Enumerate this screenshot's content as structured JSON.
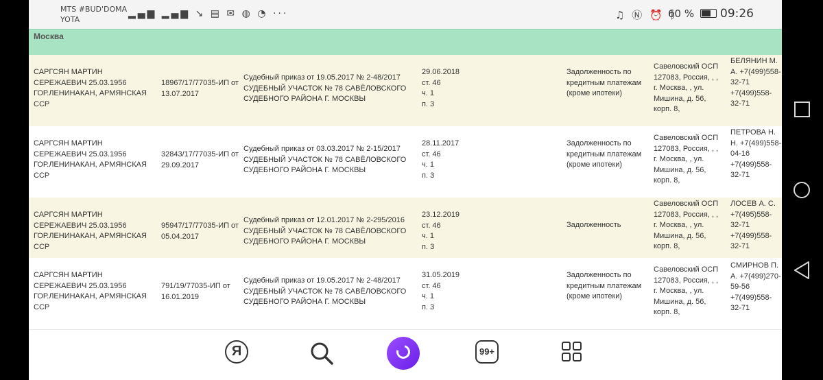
{
  "status_bar": {
    "carrier_line1": "MTS #BUD'DOMA",
    "carrier_line2": "YOTA",
    "left_icons": "📶⁴⁶📶",
    "battery_percent": "60 %",
    "time": "09:26"
  },
  "table": {
    "city": "Москва",
    "rows": [
      {
        "debtor": "САРГСЯН МАРТИН СЕРЕЖАЕВИЧ 25.03.1956 ГОР.ЛЕНИНАКАН, АРМЯНСКАЯ ССР",
        "ip": "18967/17/77035-ИП от 13.07.2017",
        "doc": "Судебный приказ от 19.05.2017 № 2-48/2017 СУДЕБНЫЙ УЧАСТОК № 78 САВЁЛОВСКОГО СУДЕБНОГО РАЙОНА Г. МОСКВЫ",
        "end": "29.06.2018\nст. 46\nч. 1\nп. 3",
        "subject": "Задолженность по кредитным платежам (кроме ипотеки)",
        "department": "Савеловский ОСП 127083, Россия, , , г. Москва, , ул. Мишина, д. 56, корп. 8,",
        "agent": "БЕЛЯНИН М. А. +7(499)558-32-71 +7(499)558-32-71"
      },
      {
        "debtor": "САРГСЯН МАРТИН СЕРЕЖАЕВИЧ 25.03.1956 ГОР.ЛЕНИНАКАН, АРМЯНСКАЯ ССР",
        "ip": "32843/17/77035-ИП от 29.09.2017",
        "doc": "Судебный приказ от 03.03.2017 № 2-15/2017 СУДЕБНЫЙ УЧАСТОК № 78 САВЁЛОВСКОГО СУДЕБНОГО РАЙОНА Г. МОСКВЫ",
        "end": "28.11.2017\nст. 46\nч. 1\nп. 3",
        "subject": "Задолженность по кредитным платежам (кроме ипотеки)",
        "department": "Савеловский ОСП 127083, Россия, , , г. Москва, , ул. Мишина, д. 56, корп. 8,",
        "agent": "ПЕТРОВА Н. Н. +7(499)558-04-16 +7(499)558-32-71"
      },
      {
        "debtor": "САРГСЯН МАРТИН СЕРЕЖАЕВИЧ 25.03.1956 ГОР.ЛЕНИНАКАН, АРМЯНСКАЯ ССР",
        "ip": "95947/17/77035-ИП от 05.04.2017",
        "doc": "Судебный приказ от 12.01.2017 № 2-295/2016 СУДЕБНЫЙ УЧАСТОК № 78 САВЁЛОВСКОГО СУДЕБНОГО РАЙОНА Г. МОСКВЫ",
        "end": "23.12.2019\nст. 46\nч. 1\nп. 3",
        "subject": "Задолженность",
        "department": "Савеловский ОСП 127083, Россия, , , г. Москва, , ул. Мишина, д. 56, корп. 8,",
        "agent": "ЛОСЕВ А. С. +7(495)558-32-71 +7(499)558-32-71"
      },
      {
        "debtor": "САРГСЯН МАРТИН СЕРЕЖАЕВИЧ 25.03.1956 ГОР.ЛЕНИНАКАН, АРМЯНСКАЯ ССР",
        "ip": "791/19/77035-ИП от 16.01.2019",
        "doc": "Судебный приказ от 19.05.2017 № 2-48/2017 СУДЕБНЫЙ УЧАСТОК № 78 САВЁЛОВСКОГО СУДЕБНОГО РАЙОНА Г. МОСКВЫ",
        "end": "31.05.2019\nст. 46\nч. 1\nп. 3",
        "subject": "Задолженность по кредитным платежам (кроме ипотеки)",
        "department": "Савеловский ОСП 127083, Россия, , , г. Москва, , ул. Мишина, д. 56, корп. 8,",
        "agent": "СМИРНОВ П. А. +7(499)270-59-56 +7(499)558-32-71"
      }
    ]
  },
  "bottom_nav": {
    "yandex_letter": "Я",
    "tabs_count": "99+",
    "icons": [
      "yandex-icon",
      "search-icon",
      "alice-icon",
      "tabs-icon",
      "grid-icon"
    ]
  },
  "colors": {
    "city_header": "#a8e4c3",
    "row_odd": "#f8f6e3",
    "alice_purple": "#7a2ff0"
  }
}
